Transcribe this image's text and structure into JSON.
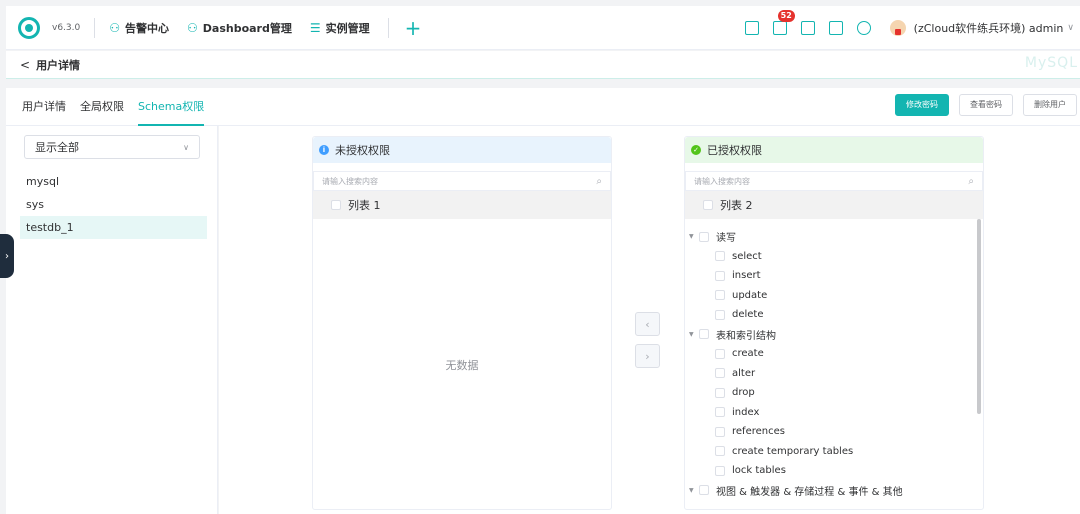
{
  "header": {
    "version": "v6.3.0",
    "nav": [
      {
        "label": "告警中心",
        "icon": "alert-center-icon"
      },
      {
        "label": "Dashboard管理",
        "icon": "dashboard-icon"
      },
      {
        "label": "实例管理",
        "icon": "instance-icon"
      }
    ],
    "notification_count": "52",
    "user_label": "(zCloud软件练兵环境) admin"
  },
  "breadcrumb": {
    "back": "<",
    "title": "用户详情",
    "watermark": "MySQL"
  },
  "tabs": [
    {
      "label": "用户详情",
      "active": false
    },
    {
      "label": "全局权限",
      "active": false
    },
    {
      "label": "Schema权限",
      "active": true
    }
  ],
  "actions": {
    "change_password": "修改密码",
    "view_password": "查看密码",
    "delete_user": "删除用户"
  },
  "schema_filter": {
    "selected": "显示全部"
  },
  "schemas": [
    "mysql",
    "sys",
    "testdb_1"
  ],
  "selected_schema": "testdb_1",
  "left_transfer": {
    "title": "未授权权限",
    "search_placeholder": "请输入搜索内容",
    "list_title": "列表 1",
    "empty_text": "无数据"
  },
  "right_transfer": {
    "title": "已授权权限",
    "search_placeholder": "请输入搜索内容",
    "list_title": "列表 2",
    "groups": [
      {
        "label": "读写",
        "items": [
          "select",
          "insert",
          "update",
          "delete"
        ]
      },
      {
        "label": "表和索引结构",
        "items": [
          "create",
          "alter",
          "drop",
          "index",
          "references",
          "create temporary tables",
          "lock tables"
        ]
      },
      {
        "label": "视图 & 触发器 & 存储过程 & 事件 & 其他",
        "items": []
      }
    ]
  },
  "colors": {
    "accent": "#13b5b1",
    "info": "#409eff",
    "success": "#52c41a",
    "badge": "#e5322d"
  }
}
